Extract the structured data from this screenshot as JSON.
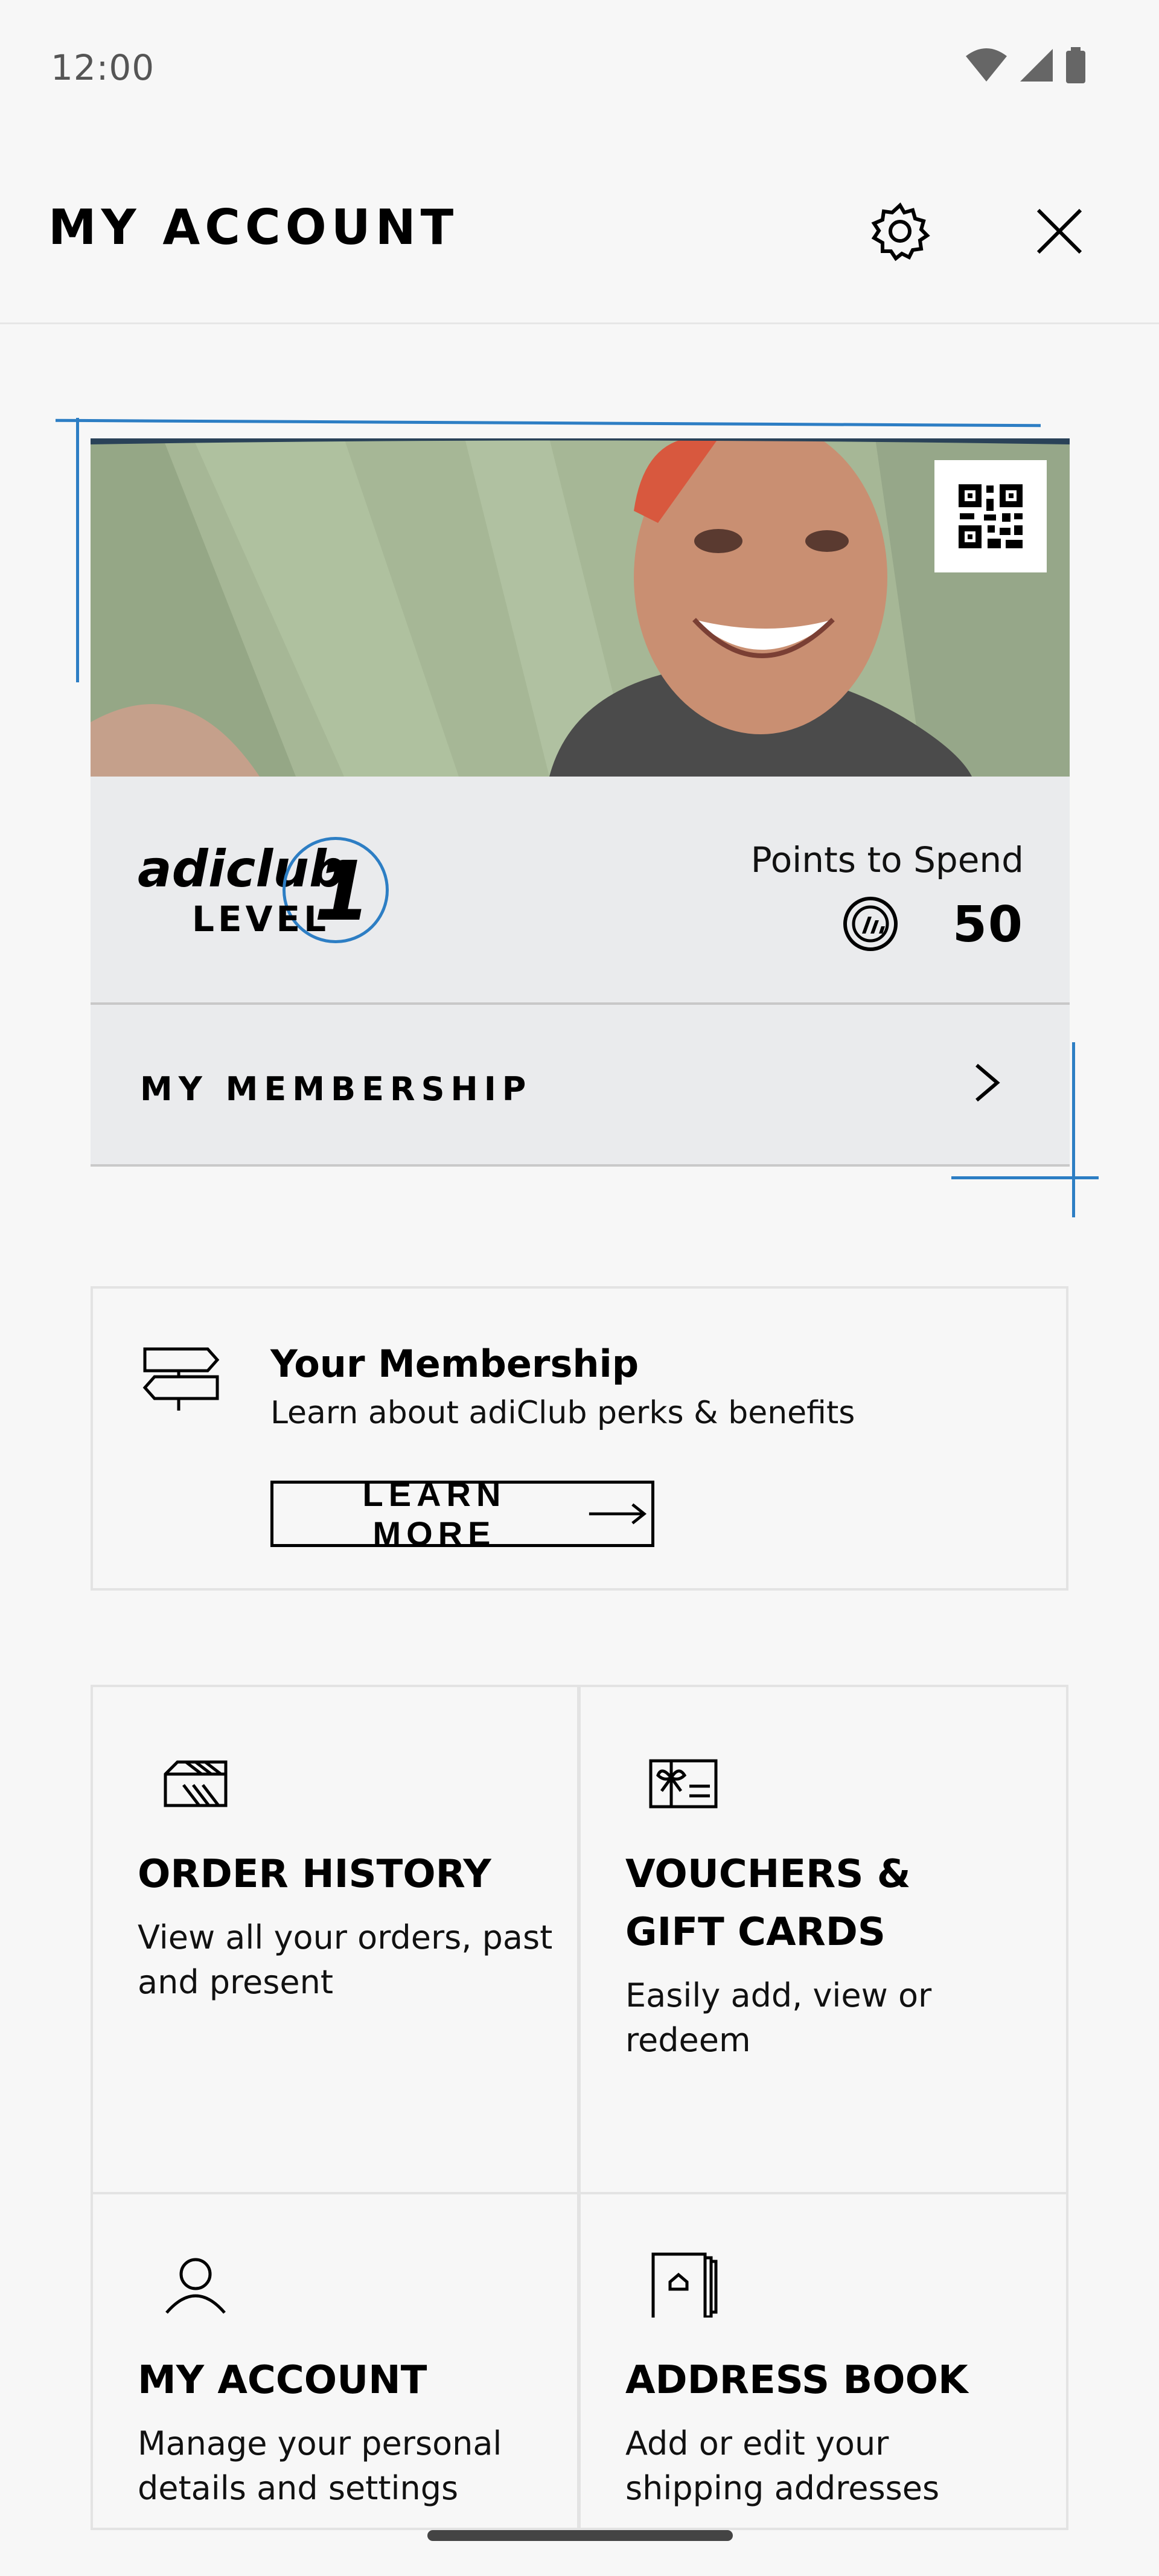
{
  "status": {
    "time": "12:00"
  },
  "header": {
    "title": "MY ACCOUNT"
  },
  "card": {
    "brand": "adiclub",
    "level_label": "LEVEL",
    "level_number": "1",
    "points_label": "Points to Spend",
    "points_value": "50",
    "membership_row_label": "MY MEMBERSHIP"
  },
  "membership_box": {
    "title": "Your Membership",
    "subtitle": "Learn about adiClub perks & benefits",
    "button_label": "LEARN MORE"
  },
  "tiles": [
    {
      "title": "ORDER HISTORY",
      "subtitle": "View all your orders, past and present"
    },
    {
      "title": "VOUCHERS & GIFT CARDS",
      "subtitle": "Easily add, view or redeem"
    },
    {
      "title": "MY ACCOUNT",
      "subtitle": "Manage your personal details and settings"
    },
    {
      "title": "ADDRESS BOOK",
      "subtitle": "Add or edit your shipping addresses"
    }
  ],
  "colors": {
    "accent_blue": "#2d7ec4",
    "card_gray": "#eaebed"
  },
  "icons": [
    "wifi-icon",
    "signal-icon",
    "battery-icon",
    "gear-icon",
    "close-icon",
    "qr-code-icon",
    "points-icon",
    "chevron-right-icon",
    "signpost-icon",
    "arrow-right-icon",
    "box-icon",
    "gift-card-icon",
    "user-icon",
    "address-book-icon"
  ]
}
